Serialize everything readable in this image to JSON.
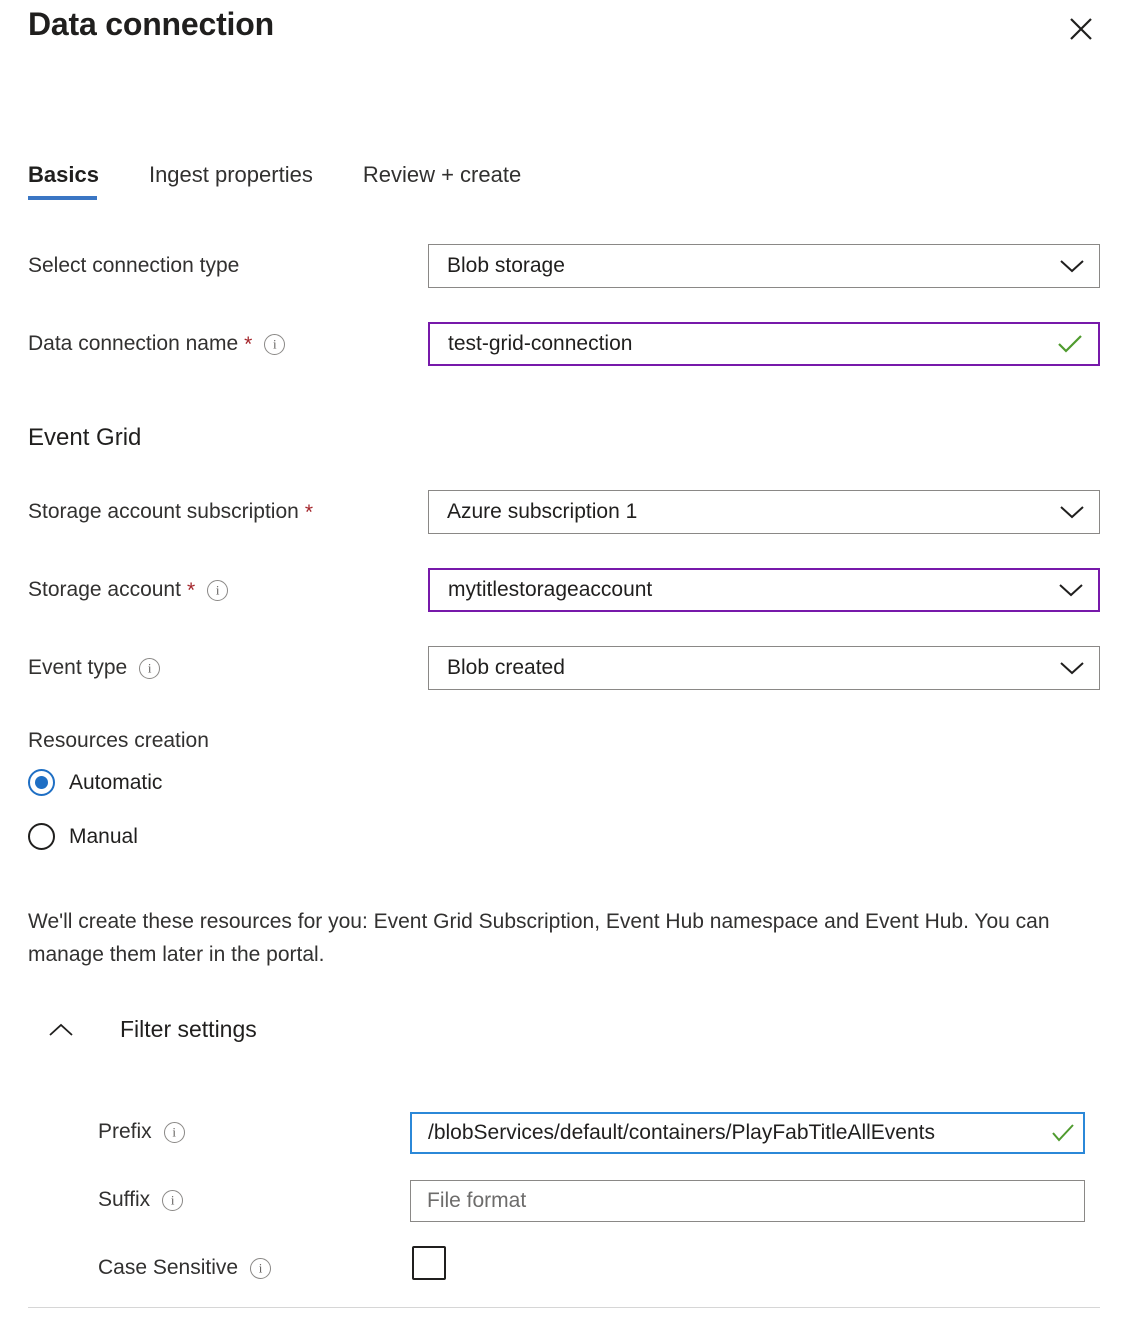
{
  "header": {
    "title": "Data connection",
    "close_label": "Close"
  },
  "tabs": [
    {
      "label": "Basics",
      "active": true
    },
    {
      "label": "Ingest properties",
      "active": false
    },
    {
      "label": "Review + create",
      "active": false
    }
  ],
  "basics": {
    "connection_type": {
      "label": "Select connection type",
      "value": "Blob storage"
    },
    "connection_name": {
      "label": "Data connection name",
      "required_marker": "*",
      "value": "test-grid-connection"
    }
  },
  "event_grid": {
    "section_title": "Event Grid",
    "storage_subscription": {
      "label": "Storage account subscription",
      "required_marker": "*",
      "value": "Azure subscription 1"
    },
    "storage_account": {
      "label": "Storage account",
      "required_marker": "*",
      "value": "mytitlestorageaccount"
    },
    "event_type": {
      "label": "Event type",
      "value": "Blob created"
    },
    "resources_creation": {
      "label": "Resources creation",
      "options": [
        {
          "label": "Automatic",
          "selected": true
        },
        {
          "label": "Manual",
          "selected": false
        }
      ]
    },
    "description": "We'll create these resources for you: Event Grid Subscription, Event Hub namespace and Event Hub. You can manage them later in the portal."
  },
  "filter_settings": {
    "title": "Filter settings",
    "expanded": true,
    "prefix": {
      "label": "Prefix",
      "value": "/blobServices/default/containers/PlayFabTitleAllEvents"
    },
    "suffix": {
      "label": "Suffix",
      "value": "",
      "placeholder": "File format"
    },
    "case_sensitive": {
      "label": "Case Sensitive",
      "checked": false
    }
  },
  "colors": {
    "accent_blue": "#3a76c4",
    "focus_blue": "#2b88d8",
    "modified_purple": "#7719aa",
    "valid_green": "#4f9b2e",
    "required_red": "#a4262c"
  }
}
